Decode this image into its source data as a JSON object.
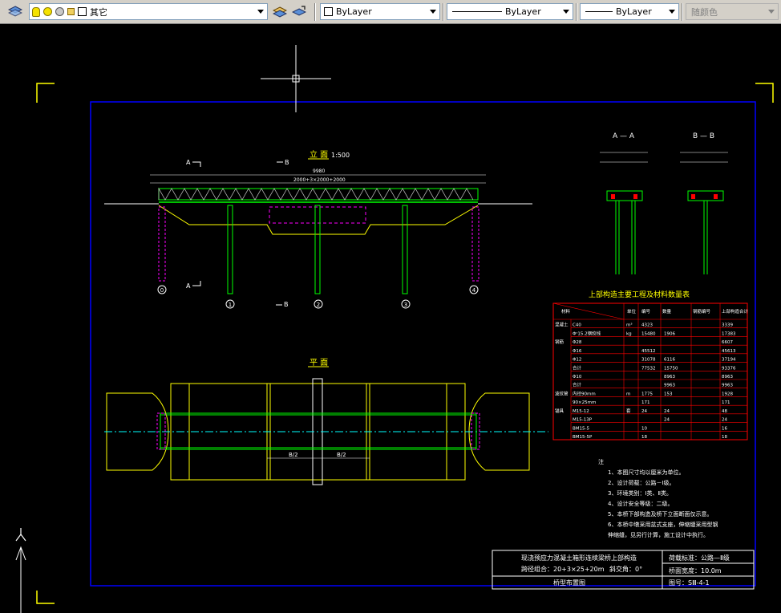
{
  "toolbar": {
    "layer_name": "其它",
    "color_combo": "ByLayer",
    "linetype_combo": "ByLayer",
    "lineweight_combo": "ByLayer",
    "plotstyle_combo": "随颜色"
  },
  "drawing": {
    "elevation_title": "立  面",
    "elevation_scale": "1:500",
    "plan_title": "平  面",
    "section_a_label": "A",
    "section_b_label": "B",
    "section_aa_title": "A — A",
    "section_bb_title": "B — B",
    "total_length": "9980",
    "span_text": "2000+3×2000+2000",
    "pier_numbers": [
      "0",
      "1",
      "2",
      "3",
      "4"
    ],
    "half_width": "B/2",
    "table_title": "上部构造主要工程及材料数量表",
    "table_headers": [
      "材料",
      "单位",
      "编号",
      "数量",
      "钢筋编号",
      "上部构造合计"
    ],
    "table_rows": [
      [
        "混凝土",
        "C40",
        "m³",
        "4323",
        "",
        "3339"
      ],
      [
        "",
        "Φˢ15.2钢绞线",
        "kg",
        "15480",
        "1906",
        "17383"
      ],
      [
        "钢筋",
        "Φ28",
        "",
        "",
        "",
        "6607"
      ],
      [
        "",
        "Φ16",
        "",
        "45512",
        "",
        "45613"
      ],
      [
        "",
        "Φ12",
        "",
        "31078",
        "6116",
        "37194"
      ],
      [
        "",
        "合计",
        "",
        "77532",
        "15750",
        "93376"
      ],
      [
        "",
        "Φ10",
        "",
        "",
        "8963",
        "8963"
      ],
      [
        "",
        "合计",
        "",
        "",
        "9963",
        "9963"
      ],
      [
        "波纹管",
        "内径90mm",
        "m",
        "1775",
        "153",
        "1928"
      ],
      [
        "",
        "90×25mm",
        "",
        "171",
        "",
        "171"
      ],
      [
        "锚具",
        "M15-12",
        "套",
        "24",
        "24",
        "48"
      ],
      [
        "",
        "M15-13P",
        "",
        "",
        "24",
        "24"
      ],
      [
        "",
        "BM15-5",
        "",
        "10",
        "",
        "16"
      ],
      [
        "",
        "BM15-5P",
        "",
        "18",
        "",
        "18"
      ]
    ],
    "notes_title": "注",
    "notes": [
      "1、本图尺寸均以厘米为单位。",
      "2、设计荷载：公路－Ⅰ级。",
      "3、环境类别：Ⅰ类、Ⅱ类。",
      "4、设计安全等级：二级。",
      "5、本桥下部构造及桥下立面断面仅示意。",
      "6、本桥中墩采用盆式支座，伸缩缝采用型钢",
      "   伸缩缝，见另行计算，施工设计中执行。"
    ],
    "title_block": {
      "project": "现浇预应力混凝土箱形连续梁桥上部构造",
      "span_combo": "跨径组合：20+3×25+20m",
      "skew": "斜交角：0°",
      "drawing_name": "桥型布置图",
      "design_standard": "荷载标准：公路—Ⅱ级",
      "deck_width": "桥面宽度：10.0m",
      "drawing_no": "图号：SⅢ-4-1"
    }
  },
  "ucs": {
    "y_label": "Y"
  }
}
